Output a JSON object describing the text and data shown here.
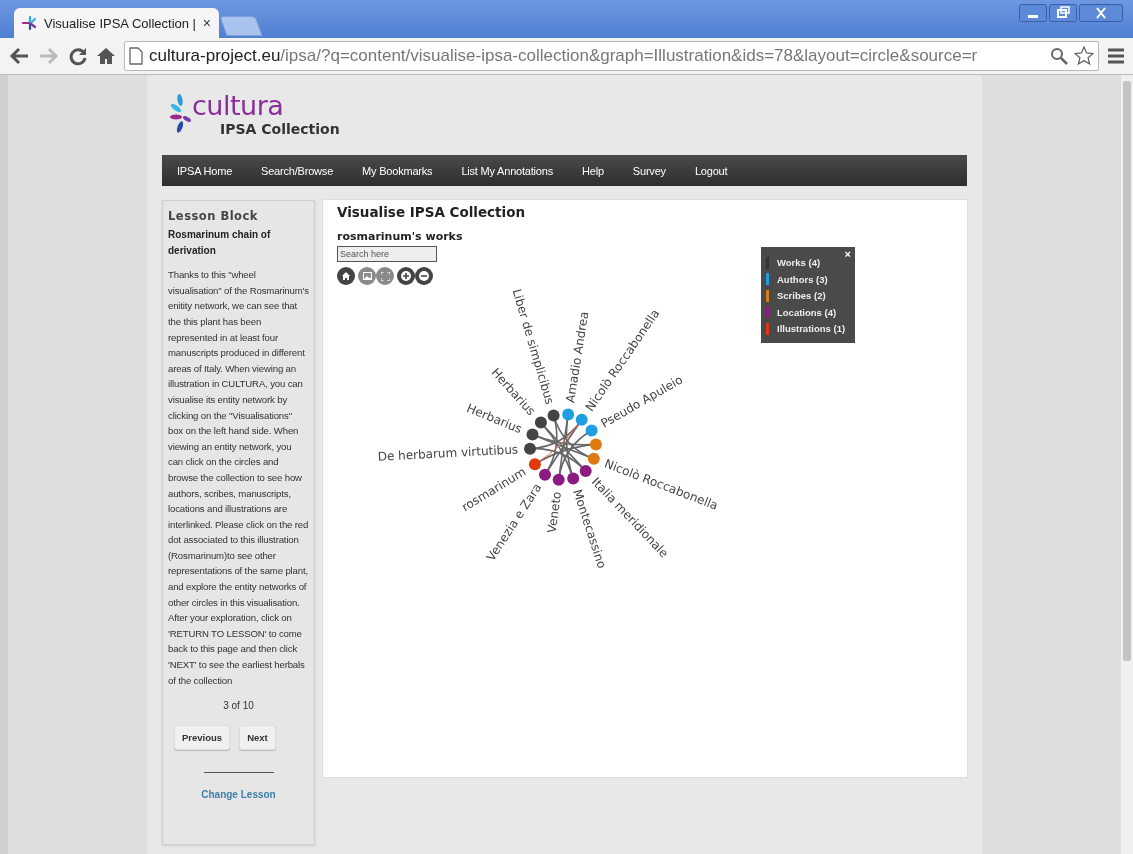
{
  "browser": {
    "tab_title": "Visualise IPSA Collection |",
    "tab_close": "×",
    "url_host": "cultura-project.eu",
    "url_path": "/ipsa/?q=content/visualise-ipsa-collection&graph=Illustration&ids=78&layout=circle&source=r"
  },
  "site": {
    "logo_text": "cultura",
    "subtitle": "IPSA Collection"
  },
  "nav": [
    {
      "label": "IPSA Home"
    },
    {
      "label": "Search/Browse"
    },
    {
      "label": "My Bookmarks"
    },
    {
      "label": "List My Annotations"
    },
    {
      "label": "Help"
    },
    {
      "label": "Survey"
    },
    {
      "label": "Logout"
    }
  ],
  "sidebar": {
    "title": "Lesson Block",
    "heading": "Rosmarinum chain of derivation",
    "body": "Thanks to this \"wheel visualisation\" of the Rosmarinum's enitity network, we can see that the this plant has been represented in at least four manuscripts produced in different areas of Italy. When viewing an illustration in CULTURA, you can visualise its entity network by clicking on the \"Visualisations\" box on the left hand side. When viewing an entity network, you can click on the circles and browse the collection to see how authors, scribes, manuscripts, locations and illustrations are interlinked. Please click on the red dot associated to this illustration (Rosmarinum)to see other representations of the same plant, and explore the entity networks of other circles in this visualisation. After your exploration, click on 'RETURN TO LESSON' to come back to this page and then click 'NEXT' to see the earliest herbals of the collection",
    "progress": "3 of 10",
    "buttons": [
      "Previous",
      "Next"
    ],
    "link": "Change Lesson"
  },
  "main": {
    "title": "Visualise IPSA Collection",
    "subtitle": "rosmarinum's works",
    "search": {
      "placeholder": "Search here"
    },
    "tools": [
      {
        "kind": "home",
        "disabled": false
      },
      {
        "kind": "image",
        "disabled": true
      },
      {
        "kind": "fullscreen",
        "disabled": true
      },
      {
        "kind": "zoom-in",
        "disabled": false
      },
      {
        "kind": "zoom-out",
        "disabled": false
      }
    ],
    "legend": {
      "close": "×",
      "items": [
        {
          "label": "Works (4)",
          "color": "#333333"
        },
        {
          "label": "Authors (3)",
          "color": "#1f9ee0"
        },
        {
          "label": "Scribes (2)",
          "color": "#de7a12"
        },
        {
          "label": "Locations (4)",
          "color": "#8c1a82"
        },
        {
          "label": "Illustrations (1)",
          "color": "#e03a0c"
        }
      ]
    },
    "graph": {
      "nodes": [
        {
          "label": "De herbarum virtutibus",
          "color": "#444444"
        },
        {
          "label": "Herbarius",
          "color": "#444444"
        },
        {
          "label": "Herbarius",
          "color": "#444444"
        },
        {
          "label": "Liber de simplicibus",
          "color": "#444444"
        },
        {
          "label": "Amadio Andrea",
          "color": "#1f9ee0"
        },
        {
          "label": "Nicolò Roccabonella",
          "color": "#1f9ee0"
        },
        {
          "label": "Pseudo Apuleio",
          "color": "#1f9ee0"
        },
        {
          "color": "#de7a12"
        },
        {
          "label": "Nicolò Roccabonella",
          "color": "#de7a12"
        },
        {
          "label": "Italia meridionale",
          "color": "#8c1a82"
        },
        {
          "label": "Montecassino",
          "color": "#8c1a82"
        },
        {
          "label": "Veneto",
          "color": "#8c1a82"
        },
        {
          "label": "Venezia e Zara",
          "color": "#8c1a82"
        },
        {
          "label": "rosmarinum",
          "color": "#e03a0c"
        }
      ]
    }
  }
}
